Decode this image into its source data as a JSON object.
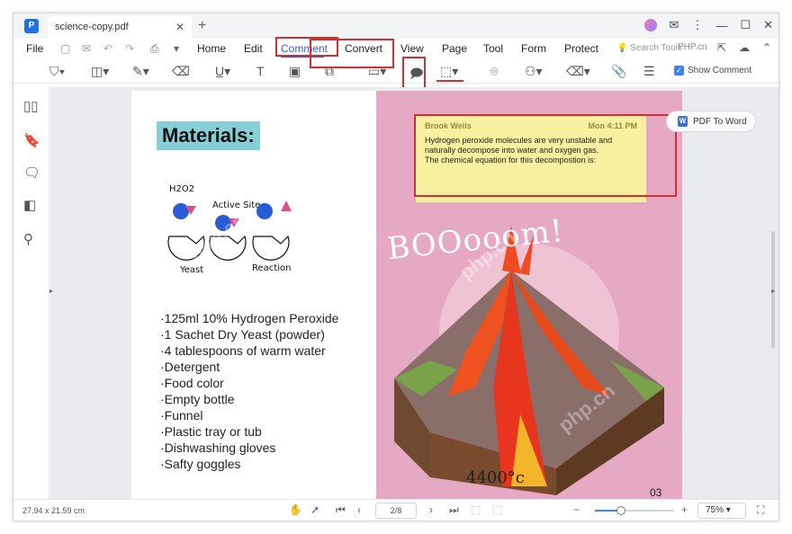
{
  "window": {
    "tab_title": "science-copy.pdf"
  },
  "menu": {
    "file": "File",
    "items": [
      "Home",
      "Edit",
      "Comment",
      "Convert",
      "View",
      "Page",
      "Tool",
      "Form",
      "Protect"
    ],
    "active": "Comment",
    "search_placeholder": "Search Tools",
    "brand": "PHP.cn"
  },
  "toolbar": {
    "show_comment_label": "Show Comment",
    "show_comment_checked": true
  },
  "document": {
    "heading": "Materials:",
    "diagram_labels": {
      "h2o2": "H2O2",
      "active_site": "Active Site",
      "yeast": "Yeast",
      "reaction": "Reaction"
    },
    "materials": [
      "125ml 10% Hydrogen Peroxide",
      "1 Sachet Dry Yeast (powder)",
      "4 tablespoons of warm water",
      "Detergent",
      "Food color",
      "Empty bottle",
      "Funnel",
      "Plastic tray or tub",
      "Dishwashing gloves",
      "Safty goggles"
    ],
    "boom_text": "BOOooom!",
    "temperature": "4400°c",
    "page_number": "03"
  },
  "comment": {
    "author": "Brook Wells",
    "time": "Mon 4:11 PM",
    "text": "Hydrogen peroxide molecules are very unstable and naturally decompose into water and oxygen gas.\nThe chemical equation for this decompostion is:"
  },
  "pdf_to_word": "PDF To Word",
  "status": {
    "dimensions": "27.94 x 21.59 cm",
    "page_indicator": "2/8",
    "zoom": "75%"
  },
  "watermark_text": "php.cn",
  "colors": {
    "accent": "#3b5bdb",
    "highlight": "#d32f2f",
    "note": "#f7f09e",
    "page_bg": "#e6a9c3",
    "heading_bg": "#86cfd6"
  }
}
